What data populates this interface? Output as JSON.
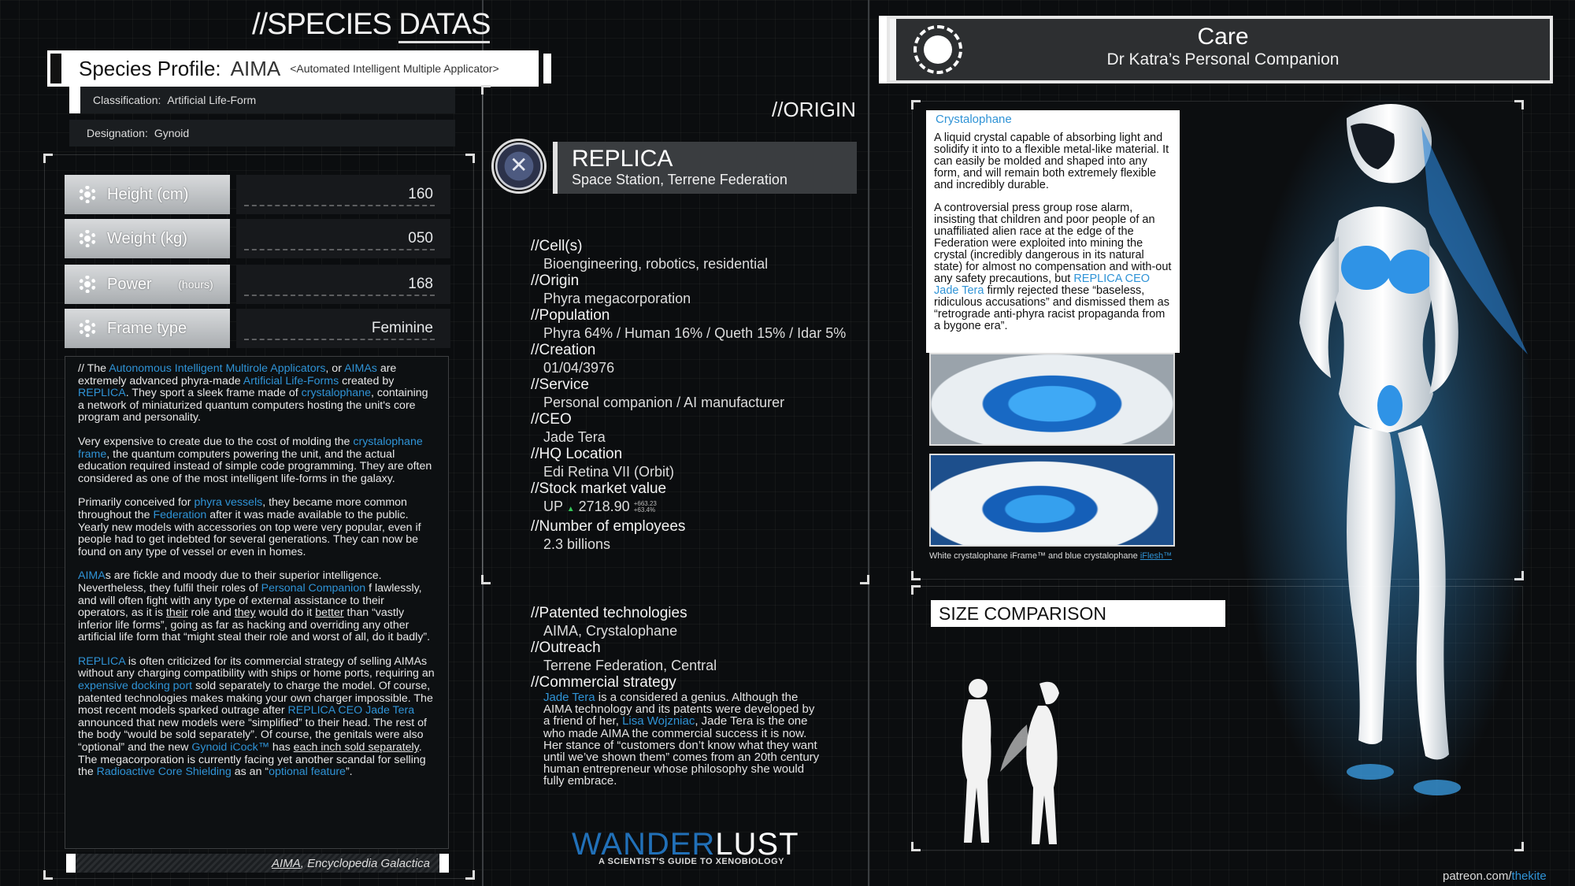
{
  "left": {
    "title_prefix": "//SPECIES ",
    "title_underlined": "DATAS",
    "profile": {
      "label": "Species Profile:",
      "name": "AIMA",
      "subtitle": "<Automated Intelligent Multiple Applicator>"
    },
    "classification_label": "Classification:",
    "classification_value": "Artificial Life-Form",
    "designation_label": "Designation:",
    "designation_value": "Gynoid",
    "stats": [
      {
        "label": "Height (cm)",
        "value": "160"
      },
      {
        "label": "Weight (kg)",
        "value": "050"
      },
      {
        "label": "Power",
        "label_small": "(hours)",
        "value": "168"
      },
      {
        "label": "Frame type",
        "value": "Feminine"
      }
    ],
    "citation_underlined": "AIMA",
    "citation_rest": ", Encyclopedia Galactica"
  },
  "desc": {
    "p1_a": "// The ",
    "p1_b": "Autonomous Intelligent Multirole Applicators",
    "p1_c": ", or ",
    "p1_d": "AIMAs",
    "p1_e": " are extremely advanced phyra-made ",
    "p1_f": "Artificial Life-Forms",
    "p1_g": " created by ",
    "p1_h": "REPLICA",
    "p1_i": ". They sport a sleek frame made of ",
    "p1_j": "crystalophane",
    "p1_k": ", containing a network of miniaturized quantum computers hosting the unit's core program and personality.",
    "p2_a": "Very expensive to create due to the cost of molding the ",
    "p2_b": "crystalophane frame",
    "p2_c": ", the quantum computers powering the unit, and the actual education required instead of simple code programming. They are often considered as one of the most intelligent life-forms in the galaxy.",
    "p3_a": "Primarily conceived for ",
    "p3_b": "phyra vessels",
    "p3_c": ", they became more common throughout the ",
    "p3_d": "Federation",
    "p3_e": " after it was made available to the public. Yearly new models with accessories on top were very popular, even if people had to get indebted for several generations. They can now be found on any type of vessel or even in homes.",
    "p4_a": "AIMA",
    "p4_b": "s are fickle and moody due to their superior intelligence. Nevertheless, they fulfil their roles of ",
    "p4_c": "Personal Companion",
    "p4_d": " f lawlessly, and will often fight with any type of external assistance to their operators, as it is ",
    "p4_e": "their",
    "p4_f": " role and ",
    "p4_g": "they",
    "p4_h": " would do it ",
    "p4_i": "better",
    "p4_j": " than “vastly inferior life forms”, going as far as hacking and overriding any other artificial life form that “might steal their role and worst of all, do it badly”.",
    "p5_a": "REPLICA",
    "p5_b": " is often criticized for its commercial strategy of selling AIMAs without any charging compatibility with ships or home ports, requiring an ",
    "p5_c": "expensive docking port",
    "p5_d": " sold separately to charge the model. Of course, patented technologies makes making your own charger impossible. The most recent models sparked outrage after ",
    "p5_e": "REPLICA CEO Jade Tera",
    "p5_f": " announced that new models were “simplified” to their head. The rest of the body “would be sold separately”. Of course, the genitals were also “optional” and the new ",
    "p5_g": "Gynoid iCock™",
    "p5_h": " has ",
    "p5_i": "each inch sold separately",
    "p5_j": ". The megacorporation is currently facing yet another scandal for selling the ",
    "p5_k": "Radioactive Core Shielding",
    "p5_l": " as an “",
    "p5_m": "optional feature",
    "p5_n": "”."
  },
  "origin": {
    "title": "//ORIGIN",
    "company": "REPLICA",
    "location": "Space Station, Terrene Federation",
    "fields": [
      {
        "h": "//Cell(s)",
        "v": "Bioengineering, robotics, residential"
      },
      {
        "h": "//Origin",
        "v": "Phyra megacorporation"
      },
      {
        "h": "//Population",
        "v": "Phyra 64% / Human 16% / Queth 15% / Idar 5%"
      },
      {
        "h": "//Creation",
        "v": "01/04/3976"
      },
      {
        "h": "//Service",
        "v": "Personal companion / AI manufacturer"
      },
      {
        "h": "//CEO",
        "v": "Jade Tera"
      },
      {
        "h": "//HQ Location",
        "v": "Edi Retina VII (Orbit)"
      }
    ],
    "stock_h": "//Stock market value",
    "stock_up": "UP",
    "stock_value": "2718.90",
    "stock_delta1": "+663.23",
    "stock_delta2": "+63.4%",
    "employees_h": "//Number of employees",
    "employees_v": "2.3 billions",
    "patents_h": "//Patented technologies",
    "patents_v": "AIMA, Crystalophane",
    "outreach_h": "//Outreach",
    "outreach_v": "Terrene Federation, Central",
    "strategy_h": "//Commercial strategy",
    "strategy_a": "Jade Tera",
    "strategy_b": " is a considered a genius. Although the AIMA technology and its patents were developed by a friend of her, ",
    "strategy_c": "Lisa Wojzniac",
    "strategy_d": ", Jade Tera is the one who made AIMA the commercial success it is now. Her stance of “customers don’t know what they want until we’ve shown them” comes from an 20th century human entrepreneur whose philosophy she would fully embrace."
  },
  "logo": {
    "wander": "WANDER",
    "lust": "LUST",
    "sub": "A SCIENTIST'S GUIDE TO XENOBIOLOGY"
  },
  "care": {
    "title": "Care",
    "subtitle": "Dr Katra’s Personal Companion"
  },
  "crystal": {
    "title": "Crystalophane",
    "p1": "A liquid crystal capable of absorbing light and solidify it into to a flexible metal-like material. It can easily be molded and shaped into any form, and will remain both extremely flexible and incredibly durable.",
    "p2_a": "A controversial press group rose alarm, insisting that children and poor people of an unaffiliated alien race at the edge of the Federation were exploited into mining the crystal (incredibly dangerous in its natural state) for almost no compensation and with-out any safety precautions, but ",
    "p2_b": "REPLICA CEO Jade Tera",
    "p2_c": " firmly rejected these “baseless, ridiculous accusations” and dismissed them as “retrograde anti-phyra racist propaganda from a bygone era”.",
    "caption_a": "White crystalophane iFrame™ and blue crystalophane ",
    "caption_b": "iFlesh™"
  },
  "size": {
    "title": "SIZE COMPARISON"
  },
  "credit": {
    "a": "patreon.com/",
    "b": "thekite"
  },
  "colors": {
    "accent": "#2f93d6",
    "glow": "#3fa9f5",
    "background": "#0b0d0f"
  }
}
